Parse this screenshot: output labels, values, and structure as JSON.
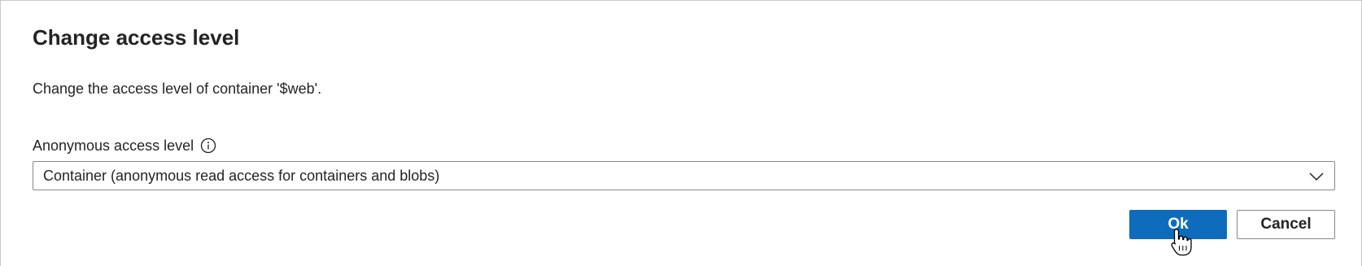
{
  "dialog": {
    "title": "Change access level",
    "description": "Change the access level of container '$web'.",
    "field": {
      "label": "Anonymous access level",
      "info_icon": "info-icon",
      "selected_value": "Container (anonymous read access for containers and blobs)",
      "dropdown_icon": "chevron-down-icon"
    },
    "buttons": {
      "ok_label": "Ok",
      "cancel_label": "Cancel"
    }
  },
  "colors": {
    "primary": "#0f6cbd",
    "text": "#242424",
    "border": "#8a8886"
  }
}
